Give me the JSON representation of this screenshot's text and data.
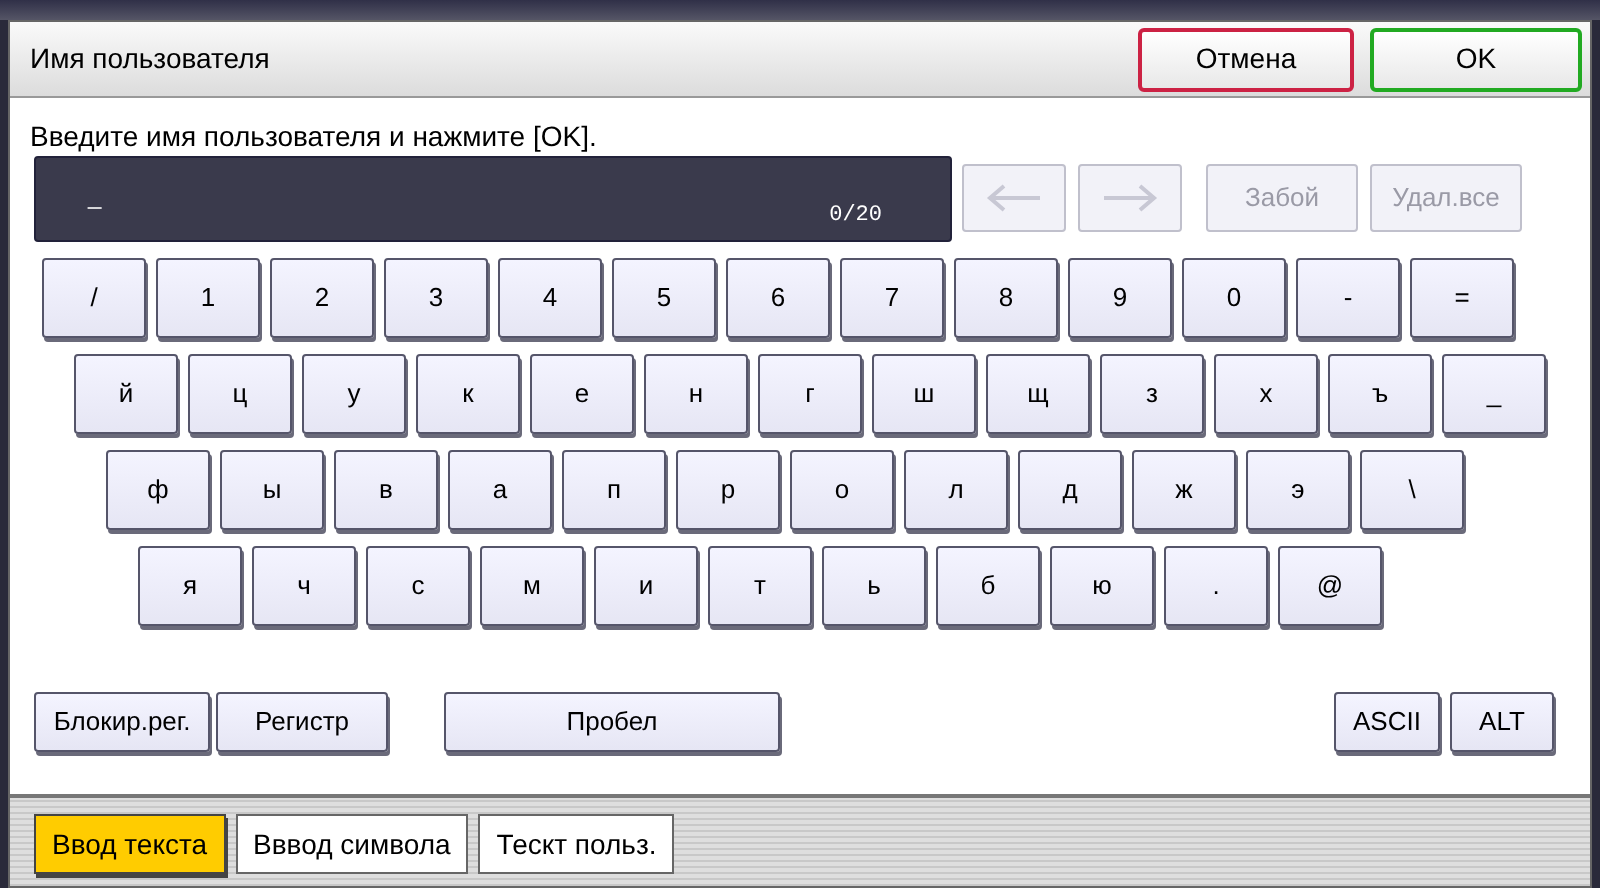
{
  "dialog": {
    "title": "Имя пользователя",
    "cancel": "Отмена",
    "ok": "OK"
  },
  "prompt": "Введите имя пользователя и нажмите [OK].",
  "input": {
    "cursor": "_",
    "counter": "0/20"
  },
  "arrows": [
    {
      "kind": "left",
      "disabled": true
    },
    {
      "kind": "right",
      "disabled": true
    }
  ],
  "edit_buttons": [
    {
      "label": "Забой",
      "disabled": true
    },
    {
      "label": "Удал.все",
      "disabled": true
    }
  ],
  "key_rows": [
    [
      "/",
      "1",
      "2",
      "3",
      "4",
      "5",
      "6",
      "7",
      "8",
      "9",
      "0",
      "-",
      "="
    ],
    [
      "й",
      "ц",
      "у",
      "к",
      "е",
      "н",
      "г",
      "ш",
      "щ",
      "з",
      "х",
      "ъ",
      "_"
    ],
    [
      "ф",
      "ы",
      "в",
      "а",
      "п",
      "р",
      "о",
      "л",
      "д",
      "ж",
      "э",
      "\\"
    ],
    [
      "я",
      "ч",
      "с",
      "м",
      "и",
      "т",
      "ь",
      "б",
      "ю",
      ".",
      "@"
    ]
  ],
  "modifiers": [
    {
      "label": "Блокир.рег.",
      "selected": false
    },
    {
      "label": "Регистр",
      "selected": false
    }
  ],
  "space": "Пробел",
  "modes": [
    {
      "label": "ASCII",
      "selected": false
    },
    {
      "label": "ALT",
      "selected": false
    }
  ],
  "tabs": [
    {
      "label": "Ввод текста",
      "selected": true
    },
    {
      "label": "Вввод символа",
      "selected": false
    },
    {
      "label": "Тескт польз.",
      "selected": false
    }
  ]
}
